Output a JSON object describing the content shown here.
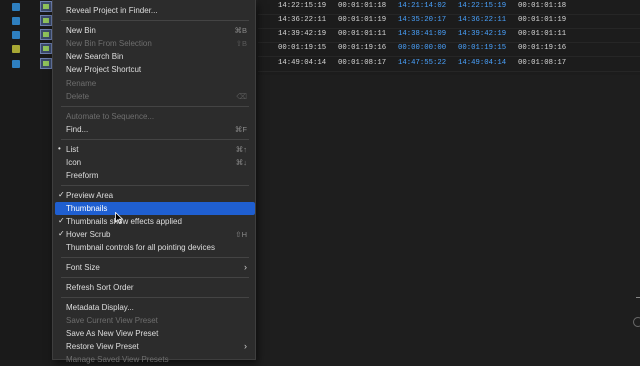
{
  "left_rows": [
    {
      "swatch": "#2e7fbf"
    },
    {
      "swatch": "#2e7fbf"
    },
    {
      "swatch": "#2e7fbf"
    },
    {
      "swatch": "#a8a834"
    },
    {
      "swatch": "#2e7fbf"
    }
  ],
  "table_rows": [
    [
      "14:22:15:19",
      "00:01:01:18",
      "14:21:14:02",
      "14:22:15:19",
      "00:01:01:18"
    ],
    [
      "14:36:22:11",
      "00:01:01:19",
      "14:35:20:17",
      "14:36:22:11",
      "00:01:01:19"
    ],
    [
      "14:39:42:19",
      "00:01:01:11",
      "14:38:41:09",
      "14:39:42:19",
      "00:01:01:11"
    ],
    [
      "00:01:19:15",
      "00:01:19:16",
      "00:00:00:00",
      "00:01:19:15",
      "00:01:19:16"
    ],
    [
      "14:49:04:14",
      "00:01:08:17",
      "14:47:55:22",
      "14:49:04:14",
      "00:01:08:17"
    ]
  ],
  "menu": {
    "reveal_project": "Reveal Project in Finder...",
    "new_bin": "New Bin",
    "new_bin_sc": "⌘B",
    "new_bin_from_selection": "New Bin From Selection",
    "new_bin_from_selection_sc": "⇧B",
    "new_search_bin": "New Search Bin",
    "new_project_shortcut": "New Project Shortcut",
    "rename": "Rename",
    "delete": "Delete",
    "delete_sc": "⌫",
    "automate": "Automate to Sequence...",
    "find": "Find...",
    "find_sc": "⌘F",
    "list": "List",
    "list_sc": "⌘↑",
    "icon": "Icon",
    "icon_sc": "⌘↓",
    "freeform": "Freeform",
    "preview_area": "Preview Area",
    "thumbnails": "Thumbnails",
    "thumbnails_effects": "Thumbnails show effects applied",
    "hover_scrub": "Hover Scrub",
    "hover_scrub_sc": "⇧H",
    "thumbnail_controls": "Thumbnail controls for all pointing devices",
    "font_size": "Font Size",
    "refresh_sort": "Refresh Sort Order",
    "metadata_display": "Metadata Display...",
    "save_current_preset": "Save Current View Preset",
    "save_as_new_preset": "Save As New View Preset",
    "restore_preset": "Restore View Preset",
    "manage_presets": "Manage Saved View Presets",
    "check": "✓",
    "bullet": "•",
    "submenu": "›"
  }
}
